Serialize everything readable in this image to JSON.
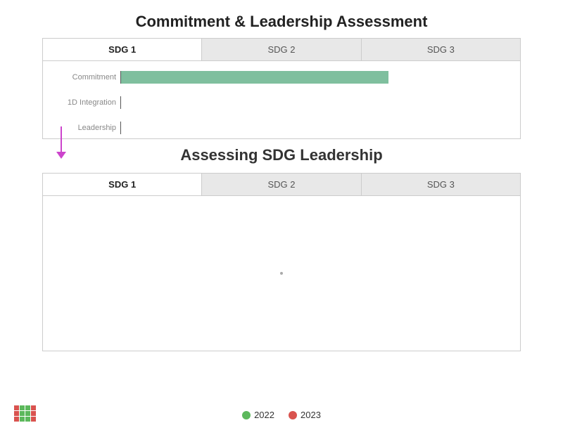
{
  "title1": "Commitment & Leadership Assessment",
  "title2": "Assessing SDG Leadership",
  "tabs1": [
    {
      "label": "SDG 1",
      "active": true
    },
    {
      "label": "SDG 2",
      "active": false
    },
    {
      "label": "SDG 3",
      "active": false
    }
  ],
  "tabs2": [
    {
      "label": "SDG 1",
      "active": true
    },
    {
      "label": "SDG 2",
      "active": false
    },
    {
      "label": "SDG 3",
      "active": false
    }
  ],
  "bars": [
    {
      "label": "Commitment",
      "widthPercent": 67
    },
    {
      "label": "1D Integration",
      "widthPercent": 0
    },
    {
      "label": "Leadership",
      "widthPercent": 0
    }
  ],
  "legend": {
    "items": [
      {
        "label": "2022",
        "color": "#5cb85c"
      },
      {
        "label": "2023",
        "color": "#d9534f"
      }
    ]
  },
  "iconColors": [
    "#d9534f",
    "#5cb85c",
    "#5cb85c",
    "#d9534f",
    "#d9534f",
    "#5cb85c",
    "#5cb85c",
    "#d9534f",
    "#d9534f",
    "#5cb85c",
    "#5cb85c",
    "#d9534f"
  ]
}
